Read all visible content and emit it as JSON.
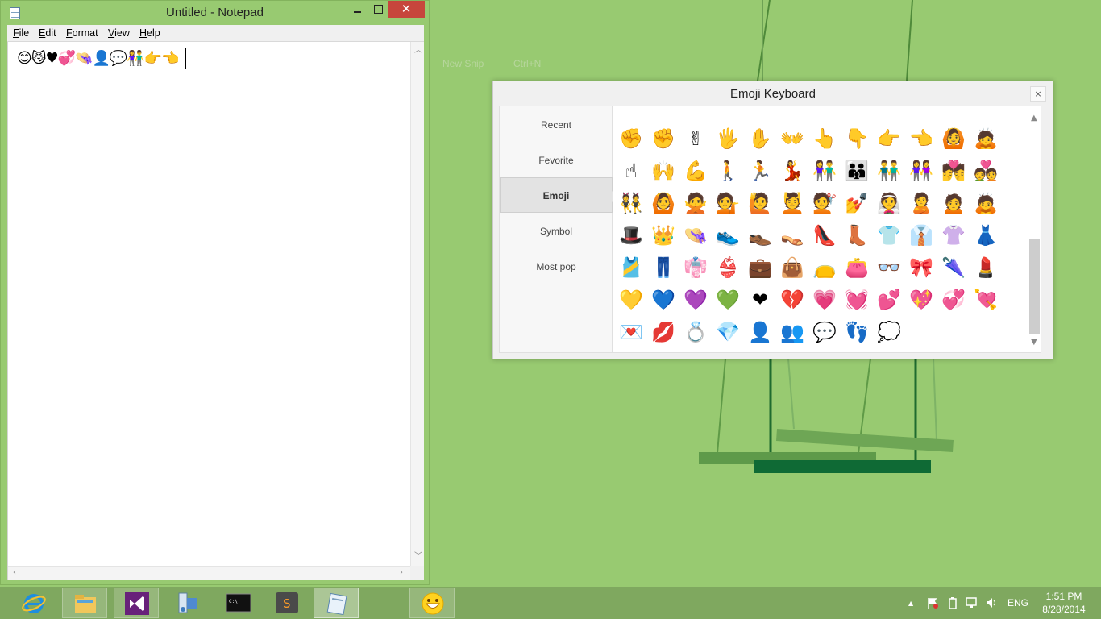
{
  "background": {
    "color": "#98ca71"
  },
  "notepad": {
    "title": "Untitled - Notepad",
    "close_glyph": "✕",
    "menu": [
      "File",
      "Edit",
      "Format",
      "View",
      "Help"
    ],
    "content": "😊😼♥💞👒👤💬👫👉👈"
  },
  "snip_hint": {
    "label": "New Snip",
    "shortcut": "Ctrl+N"
  },
  "emoji_keyboard": {
    "title": "Emoji Keyboard",
    "close_glyph": "×",
    "tabs": [
      {
        "label": "Recent",
        "active": false
      },
      {
        "label": "Fevorite",
        "active": false
      },
      {
        "label": "Emoji",
        "active": true
      },
      {
        "label": "Symbol",
        "active": false
      },
      {
        "label": "Most pop",
        "active": false
      }
    ],
    "rows": [
      [
        "✊",
        "✊",
        "✌",
        "🖐",
        "✋",
        "👐",
        "👆",
        "👇",
        "👉",
        "👈",
        "🙆",
        "🙇"
      ],
      [
        "☝",
        "🙌",
        "💪",
        "🚶",
        "🏃",
        "💃",
        "👫",
        "👪",
        "👬",
        "👭",
        "💏",
        "💑"
      ],
      [
        "👯",
        "🙆",
        "🙅",
        "💁",
        "🙋",
        "💆",
        "💇",
        "💅",
        "👰",
        "🙎",
        "🙍",
        "🙇"
      ],
      [
        "🎩",
        "👑",
        "👒",
        "👟",
        "👞",
        "👡",
        "👠",
        "👢",
        "👕",
        "👔",
        "👚",
        "👗"
      ],
      [
        "🎽",
        "👖",
        "👘",
        "👙",
        "💼",
        "👜",
        "👝",
        "👛",
        "👓",
        "🎀",
        "🌂",
        "💄"
      ],
      [
        "💛",
        "💙",
        "💜",
        "💚",
        "❤",
        "💔",
        "💗",
        "💓",
        "💕",
        "💖",
        "💞",
        "💘"
      ],
      [
        "💌",
        "💋",
        "💍",
        "💎",
        "👤",
        "👥",
        "💬",
        "👣",
        "💭"
      ]
    ]
  },
  "taskbar": {
    "apps": [
      {
        "name": "internet-explorer",
        "state": "normal"
      },
      {
        "name": "file-explorer",
        "state": "open"
      },
      {
        "name": "visual-studio",
        "state": "open"
      },
      {
        "name": "network-tool",
        "state": "normal"
      },
      {
        "name": "command-prompt",
        "state": "normal"
      },
      {
        "name": "sublime-text",
        "state": "normal"
      },
      {
        "name": "notepad",
        "state": "active"
      },
      {
        "name": "emoji-keyboard",
        "state": "open"
      }
    ],
    "cmd_text": "C:\\_",
    "sublime_letter": "S",
    "tray_chevron": "▲",
    "language": "ENG",
    "time": "1:51 PM",
    "date": "8/28/2014"
  }
}
